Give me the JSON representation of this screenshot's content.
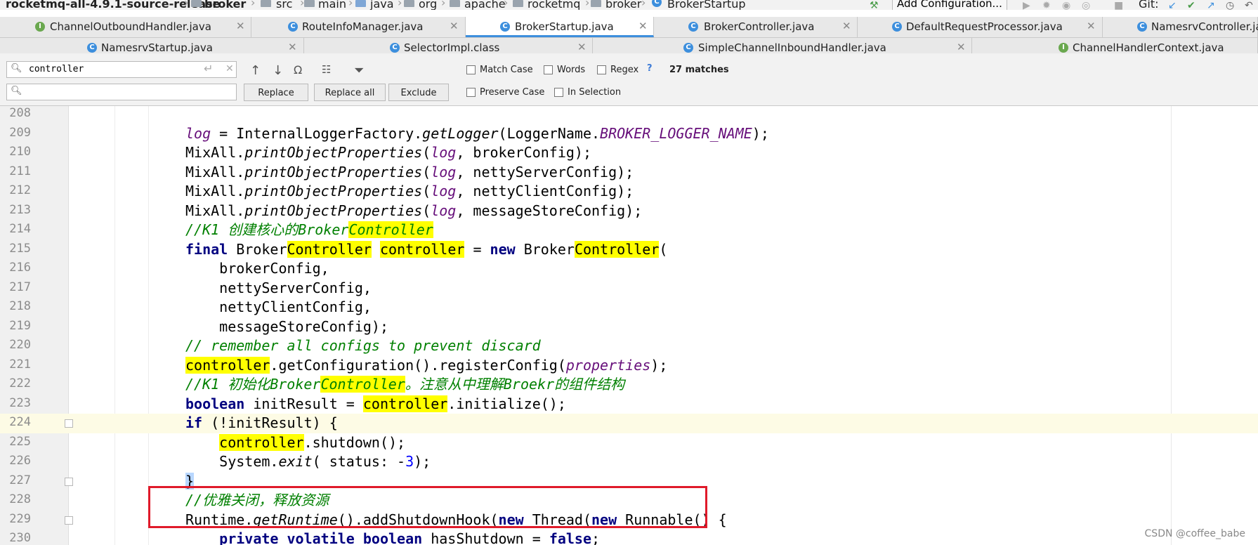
{
  "breadcrumb": {
    "project": "rocketmq-all-4.9.1-source-release",
    "items": [
      "broker",
      "src",
      "main",
      "java",
      "org",
      "apache",
      "rocketmq",
      "broker",
      "BrokerStartup"
    ],
    "add_configuration": "Add Configuration...",
    "git_label": "Git:"
  },
  "tabs_row1": [
    {
      "label": "ChannelOutboundHandler.java",
      "icon": "interface-icon"
    },
    {
      "label": "RouteInfoManager.java",
      "icon": "class-icon"
    },
    {
      "label": "BrokerStartup.java",
      "icon": "class-icon",
      "active": true
    },
    {
      "label": "BrokerController.java",
      "icon": "class-icon"
    },
    {
      "label": "DefaultRequestProcessor.java",
      "icon": "class-icon"
    },
    {
      "label": "NamesrvController.java",
      "icon": "class-icon"
    }
  ],
  "tabs_row2": [
    {
      "label": "NamesrvStartup.java",
      "icon": "class-icon"
    },
    {
      "label": "SelectorImpl.class",
      "icon": "class-icon"
    },
    {
      "label": "SimpleChannelInboundHandler.java",
      "icon": "class-icon"
    },
    {
      "label": "ChannelHandlerContext.java",
      "icon": "interface-icon"
    }
  ],
  "find": {
    "search_value": "controller",
    "replace_value": "",
    "replace_label": "Replace",
    "replace_all_label": "Replace all",
    "exclude_label": "Exclude",
    "match_case": "Match Case",
    "words": "Words",
    "regex": "Regex",
    "help": "?",
    "matches": "27 matches",
    "preserve_case": "Preserve Case",
    "in_selection": "In Selection"
  },
  "editor": {
    "line_numbers": [
      "208",
      "209",
      "210",
      "211",
      "212",
      "213",
      "214",
      "215",
      "216",
      "217",
      "218",
      "219",
      "220",
      "221",
      "222",
      "223",
      "224",
      "225",
      "226",
      "227",
      "228",
      "229",
      "230"
    ],
    "code_lines": [
      "",
      "log = InternalLoggerFactory.getLogger(LoggerName.BROKER_LOGGER_NAME);",
      "MixAll.printObjectProperties(log, brokerConfig);",
      "MixAll.printObjectProperties(log, nettyServerConfig);",
      "MixAll.printObjectProperties(log, nettyClientConfig);",
      "MixAll.printObjectProperties(log, messageStoreConfig);",
      "//K1 创建核心的BrokerController",
      "final BrokerController controller = new BrokerController(",
      "    brokerConfig,",
      "    nettyServerConfig,",
      "    nettyClientConfig,",
      "    messageStoreConfig);",
      "// remember all configs to prevent discard",
      "controller.getConfiguration().registerConfig(properties);",
      "//K1 初始化BrokerController。注意从中理解Broekr的组件结构",
      "boolean initResult = controller.initialize();",
      "if (!initResult) {",
      "    controller.shutdown();",
      "    System.exit( status: -3);",
      "}",
      "//优雅关闭，释放资源",
      "Runtime.getRuntime().addShutdownHook(new Thread(new Runnable() {",
      "    private volatile boolean hasShutdown = false;"
    ],
    "parameter_hint": "status:",
    "search_highlight_term": "controller"
  },
  "annotation": {
    "color": "#e01a2a"
  },
  "watermark": "CSDN @coffee_babe"
}
